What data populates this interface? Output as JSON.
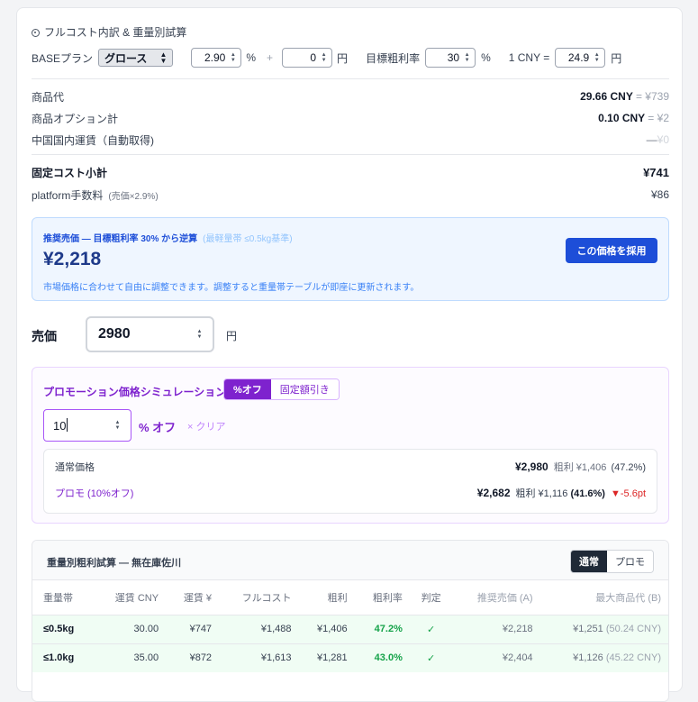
{
  "section_title": "フルコスト内訳 & 重量別試算",
  "controls": {
    "base_plan_label": "BASEプラン",
    "base_plan_value": "グロース",
    "fee_percent": "2.90",
    "percent_sign": "%",
    "plus": "+",
    "fee_fixed": "0",
    "yen": "円",
    "target_margin_label": "目標粗利率",
    "target_margin_value": "30",
    "cny_label": "1 CNY =",
    "cny_rate": "24.9"
  },
  "breakdown": {
    "product_label": "商品代",
    "product_cny": "29.66 CNY",
    "product_jpy": "= ¥739",
    "option_label": "商品オプション計",
    "option_cny": "0.10 CNY",
    "option_jpy": "= ¥2",
    "domestic_label": "中国国内運賃（自動取得)",
    "domestic_dash": "—",
    "domestic_jpy": "¥0",
    "fixed_label": "固定コスト小計",
    "fixed_value": "¥741",
    "platform_label": "platform手数料",
    "platform_note": "(売価×2.9%)",
    "platform_value": "¥86"
  },
  "recommend": {
    "title": "推奨売価 — 目標粗利率 30% から逆算",
    "subtitle": "(最軽量帯 ≤0.5kg基準)",
    "price": "¥2,218",
    "note": "市場価格に合わせて自由に調整できます。調整すると重量帯テーブルが即座に更新されます。",
    "adopt_button": "この価格を採用"
  },
  "sale_price": {
    "label": "売価",
    "value": "2980",
    "unit": "円"
  },
  "promo": {
    "title": "プロモーション価格シミュレーション",
    "mode_percent": "%オフ",
    "mode_fixed": "固定額引き",
    "input_value": "10",
    "unit": "% オフ",
    "clear": "× クリア",
    "normal_label": "通常価格",
    "normal_price": "¥2,980",
    "normal_margin": "粗利 ¥1,406",
    "normal_pct": "(47.2%)",
    "promo_label": "プロモ (10%オフ)",
    "promo_price": "¥2,682",
    "promo_margin": "粗利 ¥1,116",
    "promo_pct": "(41.6%)",
    "promo_delta": "▼-5.6pt"
  },
  "weight_table": {
    "title": "重量別粗利試算 — 無在庫佐川",
    "toggle_normal": "通常",
    "toggle_promo": "プロモ",
    "headers": [
      "重量帯",
      "運賃 CNY",
      "運賃 ¥",
      "フルコスト",
      "粗利",
      "粗利率",
      "判定",
      "推奨売価 (A)",
      "最大商品代 (B)"
    ],
    "rows": [
      {
        "band": "≤0.5kg",
        "cny": "30.00",
        "jpy": "¥747",
        "full": "¥1,488",
        "margin": "¥1,406",
        "rate": "47.2%",
        "ok": "✓",
        "rec": "¥2,218",
        "max": "¥1,251",
        "max_cny": "(50.24 CNY)"
      },
      {
        "band": "≤1.0kg",
        "cny": "35.00",
        "jpy": "¥872",
        "full": "¥1,613",
        "margin": "¥1,281",
        "rate": "43.0%",
        "ok": "✓",
        "rec": "¥2,404",
        "max": "¥1,126",
        "max_cny": "(45.22 CNY)"
      }
    ]
  }
}
